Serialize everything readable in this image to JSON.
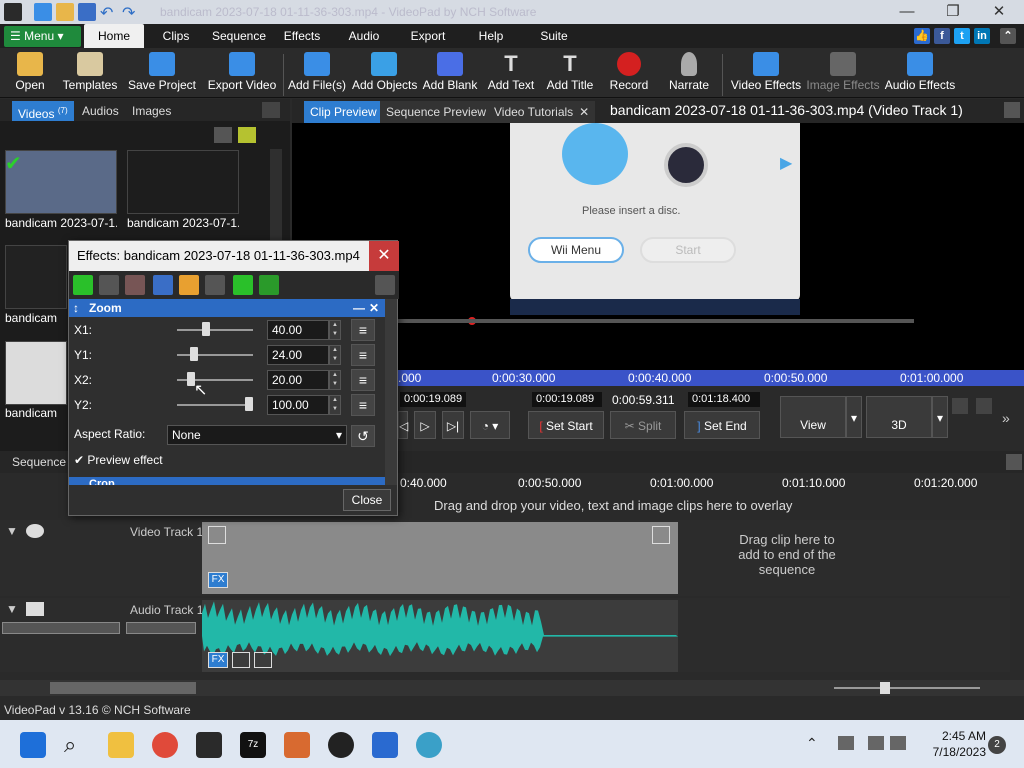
{
  "window": {
    "title": "bandicam 2023-07-18 01-11-36-303.mp4 - VideoPad by NCH Software"
  },
  "menu": {
    "label": "Menu"
  },
  "tabs": [
    "Home",
    "Clips",
    "Sequence",
    "Effects",
    "Audio",
    "Export",
    "Help",
    "Suite"
  ],
  "ribbon": [
    {
      "label": "Open",
      "color": "#e8b64a"
    },
    {
      "label": "Templates",
      "color": "#d9c9a0"
    },
    {
      "label": "Save Project",
      "color": "#3a8ee6"
    },
    {
      "label": "Export Video",
      "color": "#3a8ee6"
    },
    {
      "label": "Add File(s)",
      "color": "#3a8ee6"
    },
    {
      "label": "Add Objects",
      "color": "#3aa0e6"
    },
    {
      "label": "Add Blank",
      "color": "#4a6ee6"
    },
    {
      "label": "Add Text",
      "color": "#dddddd"
    },
    {
      "label": "Add Title",
      "color": "#dddddd"
    },
    {
      "label": "Record",
      "color": "#d42020"
    },
    {
      "label": "Narrate",
      "color": "#aaaaaa"
    },
    {
      "label": "Video Effects",
      "color": "#3a8ee6"
    },
    {
      "label": "Image Effects",
      "color": "#777777"
    },
    {
      "label": "Audio Effects",
      "color": "#3a8ee6"
    }
  ],
  "bin": {
    "tabs": [
      {
        "label": "Videos",
        "count": "(7)"
      },
      {
        "label": "Audios"
      },
      {
        "label": "Images"
      }
    ],
    "clips": [
      "bandicam 2023-07-1...",
      "bandicam 2023-07-1...",
      "bandicam",
      "bandicam"
    ]
  },
  "preview": {
    "tabs": [
      "Clip Preview",
      "Sequence Preview",
      "Video Tutorials"
    ],
    "title": "bandicam 2023-07-18 01-11-36-303.mp4 (Video Track 1)",
    "screen": {
      "insert_text": "Please insert a disc.",
      "menu_btn": "Wii Menu",
      "start_btn": "Start"
    },
    "ticks": [
      ".000",
      "0:00:30.000",
      "0:00:40.000",
      "0:00:50.000",
      "0:01:00.000"
    ],
    "time_start": "0:00:19.089",
    "time_a": "0:00:19.089",
    "time_b": "0:00:59.311",
    "time_c": "0:01:18.400",
    "set_start": "Set Start",
    "split": "Split",
    "set_end": "Set End",
    "view": "View",
    "threed": "3D"
  },
  "sequence": {
    "label": "Sequence",
    "ruler": [
      "0:40.000",
      "0:00:50.000",
      "0:01:00.000",
      "0:01:10.000",
      "0:01:20.000"
    ],
    "drop_hint": "Drag and drop your video, text and image clips here to overlay",
    "video_track": "Video Track 1",
    "audio_track": "Audio Track 1",
    "end_hint": "Drag clip here to add to end of the sequence",
    "fx": "FX"
  },
  "status": "VideoPad v 13.16 © NCH Software",
  "clock": {
    "time": "2:45 AM",
    "date": "7/18/2023",
    "badge": "2"
  },
  "effects": {
    "title": "Effects: bandicam 2023-07-18 01-11-36-303.mp4",
    "section": "Zoom",
    "section2": "Crop",
    "params": [
      {
        "label": "X1:",
        "value": "40.00",
        "level": 0.4
      },
      {
        "label": "Y1:",
        "value": "24.00",
        "level": 0.24
      },
      {
        "label": "X2:",
        "value": "20.00",
        "level": 0.2
      },
      {
        "label": "Y2:",
        "value": "100.00",
        "level": 1.0
      }
    ],
    "aspect_label": "Aspect Ratio:",
    "aspect_value": "None",
    "preview_effect": "Preview effect",
    "close": "Close"
  }
}
